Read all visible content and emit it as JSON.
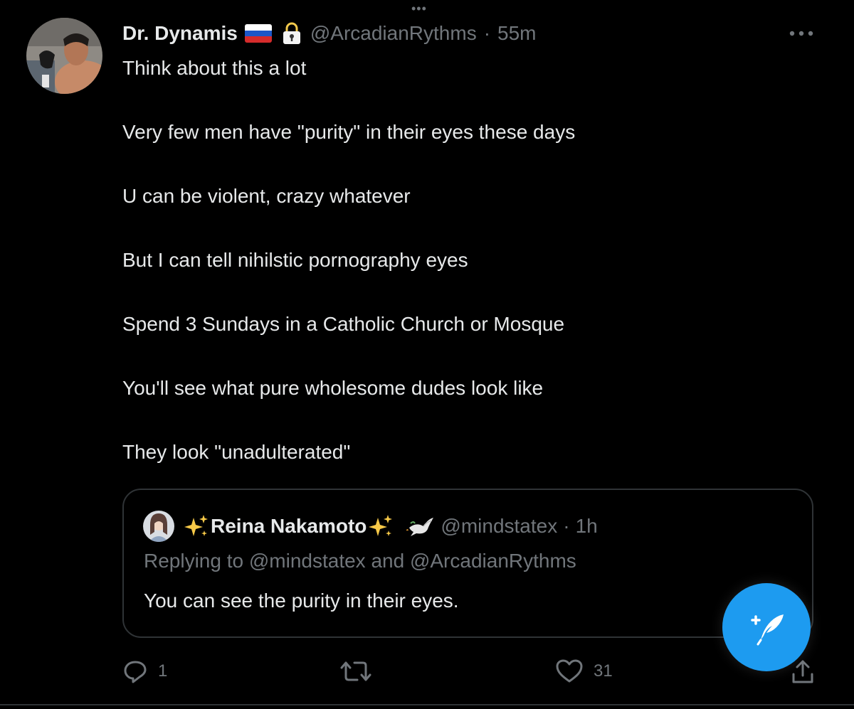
{
  "author": {
    "display_name": "Dr. Dynamis",
    "handle": "@ArcadianRythms",
    "time": "55m",
    "flag_icon": "russia-flag-icon",
    "lock_icon": "lock-icon"
  },
  "tweet": {
    "lines": [
      "Think about this a lot",
      "Very few men have \"purity\" in their eyes these days",
      "U can be violent, crazy whatever",
      "But I can tell nihilstic pornography eyes",
      "Spend 3 Sundays in a Catholic Church or Mosque",
      "You'll see what pure wholesome dudes look like",
      "They look \"unadulterated\""
    ]
  },
  "quoted": {
    "display_name": "Reina Nakamoto",
    "handle": "@mindstatex",
    "time": "1h",
    "replying_to": "Replying to @mindstatex and @ArcadianRythms",
    "text": "You can see the purity in their eyes."
  },
  "actions": {
    "reply_count": "1",
    "retweet_count": "",
    "like_count": "31"
  },
  "colors": {
    "background": "#000000",
    "text": "#e7e9ea",
    "muted": "#71767b",
    "border": "#2f3336",
    "accent": "#1d9bf0"
  }
}
